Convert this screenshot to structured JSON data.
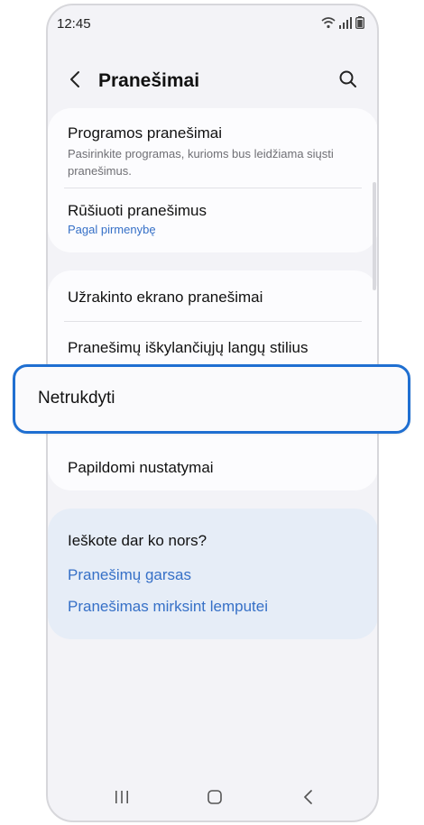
{
  "status_bar": {
    "time": "12:45"
  },
  "header": {
    "title": "Pranešimai"
  },
  "card_1": {
    "app_notifications": {
      "title": "Programos pranešimai",
      "subtitle": "Pasirinkite programas, kurioms bus leidžiama siųsti pranešimus."
    },
    "sort_notifications": {
      "title": "Rūšiuoti pranešimus",
      "value": "Pagal pirmenybę"
    }
  },
  "card_2": {
    "lock_screen": "Užrakinto ekrano pranešimai",
    "popup_style": "Pranešimų iškylančiųjų langų stilius",
    "do_not_disturb": "Netrukdyti",
    "advanced": "Papildomi nustatymai"
  },
  "suggestions": {
    "title": "Ieškote dar ko nors?",
    "links": [
      "Pranešimų garsas",
      "Pranešimas mirksint lemputei"
    ]
  },
  "colors": {
    "accent": "#3670c7",
    "highlight_border": "#1f6fd1",
    "background": "#f3f3f7"
  },
  "icons": {
    "back": "back-arrow-icon",
    "search": "search-icon",
    "recents": "recents-icon",
    "home": "home-icon",
    "nav_back": "nav-back-icon"
  }
}
